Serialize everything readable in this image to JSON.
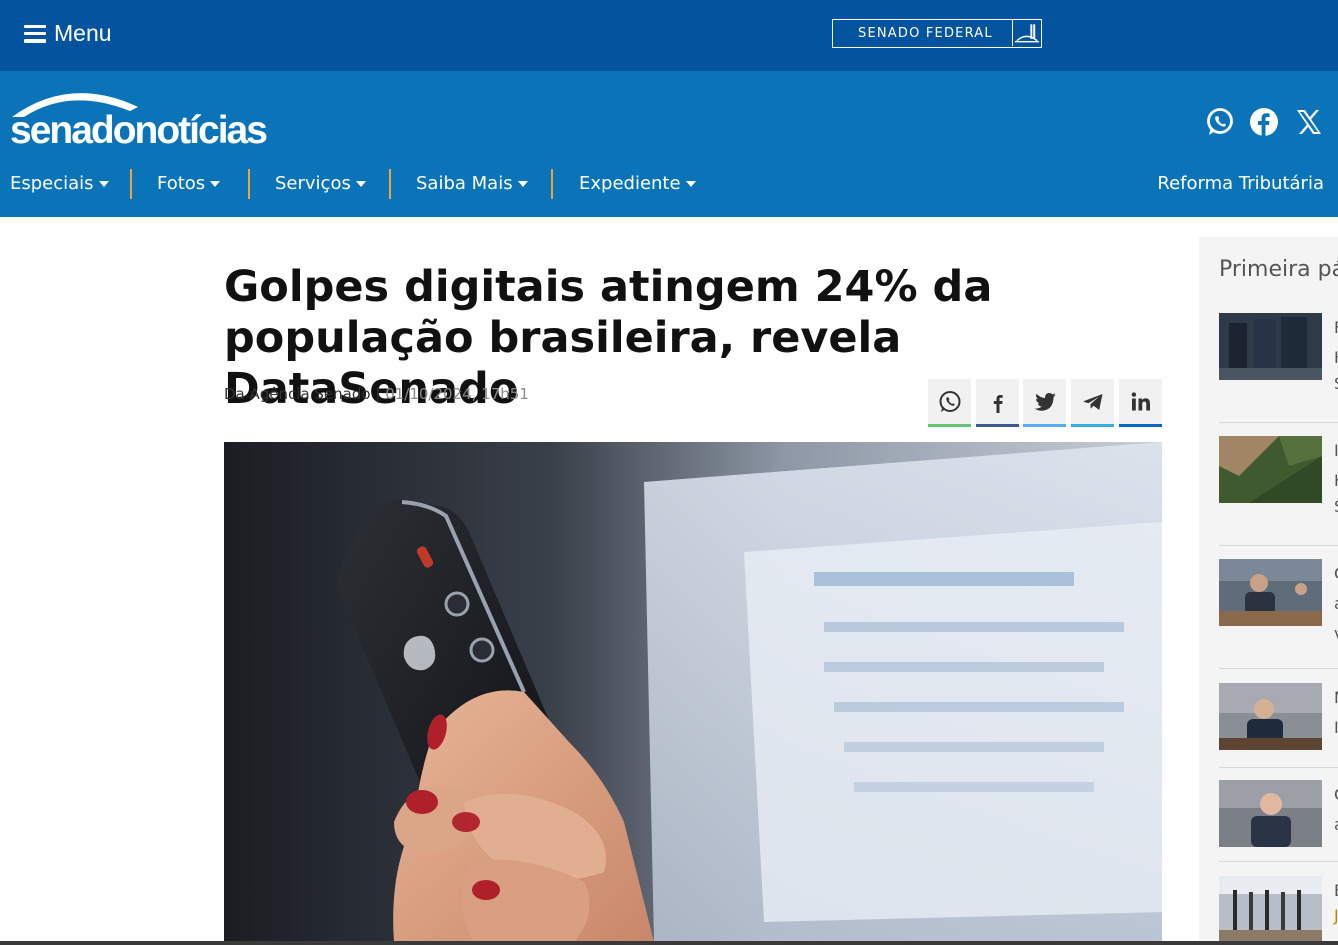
{
  "topbar": {
    "menu_label": "Menu",
    "brand_label": "SENADO FEDERAL"
  },
  "header": {
    "logo_text": "senadonotícias",
    "social": [
      "whatsapp-icon",
      "facebook-icon",
      "x-icon"
    ],
    "nav": [
      {
        "label": "Especiais"
      },
      {
        "label": "Fotos"
      },
      {
        "label": "Serviços"
      },
      {
        "label": "Saiba Mais"
      },
      {
        "label": "Expediente"
      }
    ],
    "nav_right": "Reforma Tributária"
  },
  "article": {
    "headline": "Golpes digitais atingem 24% da população brasileira, revela DataSenado",
    "source": "Da Agência Senado",
    "separator": "|",
    "date": "01/10/2024, 17h51",
    "share": [
      "whatsapp-icon",
      "facebook-icon",
      "twitter-icon",
      "telegram-icon",
      "linkedin-icon"
    ]
  },
  "sidebar": {
    "title": "Primeira pá",
    "items": [
      {
        "letters": [
          "F",
          "H",
          "S"
        ]
      },
      {
        "letters": [
          "I",
          "H",
          "S"
        ]
      },
      {
        "letters": [
          "C",
          "a",
          "v"
        ]
      },
      {
        "letters": [
          "N",
          "I"
        ]
      },
      {
        "letters": [
          "C",
          "a"
        ]
      },
      {
        "letters": [
          "E",
          "J"
        ]
      }
    ]
  },
  "colors": {
    "topbar": "#03539e",
    "header": "#0b74b8",
    "nav_separator": "#f0a23a"
  }
}
